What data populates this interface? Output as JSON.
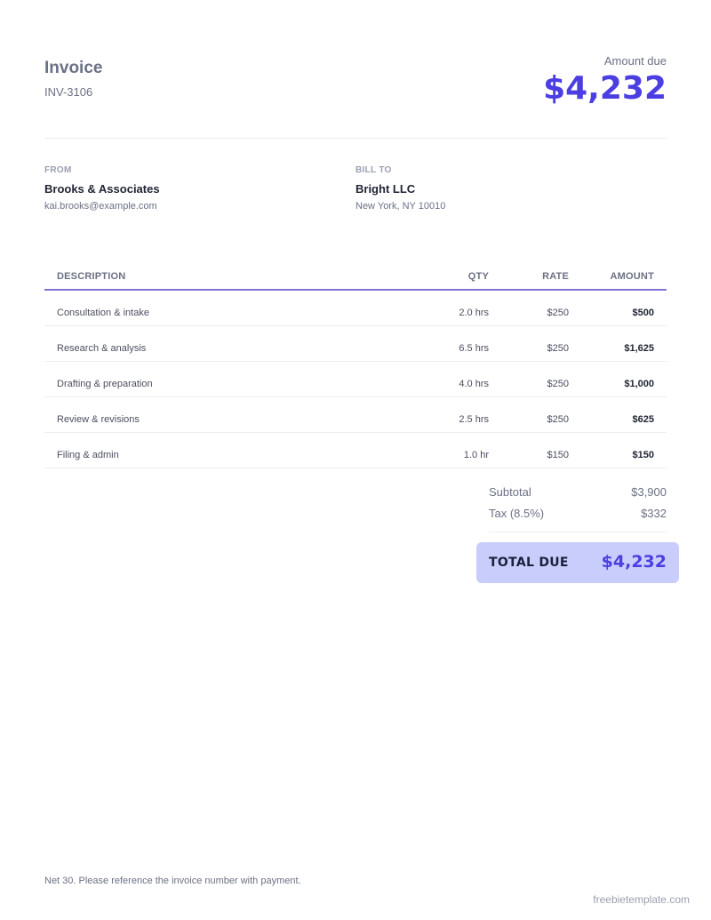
{
  "header": {
    "title": "Invoice",
    "invoice_number": "INV-3106",
    "amount_due_label": "Amount due",
    "amount_due_value": "$4,232"
  },
  "from": {
    "label": "FROM",
    "name": "Brooks & Associates",
    "detail": "kai.brooks@example.com"
  },
  "bill_to": {
    "label": "BILL TO",
    "name": "Bright LLC",
    "detail": "New York, NY 10010"
  },
  "table": {
    "headers": {
      "description": "DESCRIPTION",
      "qty": "QTY",
      "rate": "RATE",
      "amount": "AMOUNT"
    },
    "rows": [
      {
        "description": "Consultation & intake",
        "qty": "2.0 hrs",
        "rate": "$250",
        "amount": "$500"
      },
      {
        "description": "Research & analysis",
        "qty": "6.5 hrs",
        "rate": "$250",
        "amount": "$1,625"
      },
      {
        "description": "Drafting & preparation",
        "qty": "4.0 hrs",
        "rate": "$250",
        "amount": "$1,000"
      },
      {
        "description": "Review & revisions",
        "qty": "2.5 hrs",
        "rate": "$250",
        "amount": "$625"
      },
      {
        "description": "Filing & admin",
        "qty": "1.0 hr",
        "rate": "$150",
        "amount": "$150"
      }
    ]
  },
  "totals": {
    "subtotal_label": "Subtotal",
    "subtotal_value": "$3,900",
    "tax_label": "Tax (8.5%)",
    "tax_value": "$332",
    "total_due_label": "TOTAL DUE",
    "total_due_value": "$4,232"
  },
  "footer": {
    "note": "Net 30. Please reference the invoice number with payment.",
    "watermark": "freebietemplate.com"
  },
  "colors": {
    "accent": "#4b3ee3",
    "total_bg": "#c9cdfb",
    "rule": "#7f74cf"
  }
}
